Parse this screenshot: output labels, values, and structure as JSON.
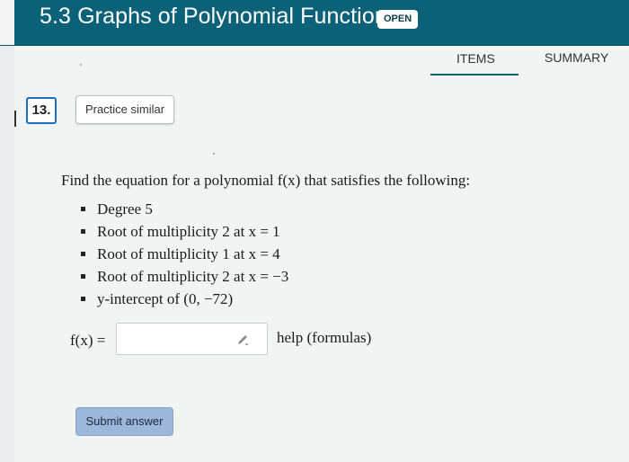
{
  "header": {
    "title": "5.3 Graphs of Polynomial Functions",
    "badge": "OPEN"
  },
  "tabs": {
    "items": "ITEMS",
    "summary": "SUMMARY",
    "active": "ITEMS"
  },
  "question": {
    "number": "13.",
    "practice_label": "Practice similar",
    "prompt": "Find the equation for a polynomial f(x) that satisfies the following:",
    "requirements": [
      "Degree 5",
      "Root of multiplicity 2 at x = 1",
      "Root of multiplicity 1 at x = 4",
      "Root of multiplicity 2 at x = −3",
      "y-intercept of (0, −72)"
    ],
    "answer_label": "f(x) =",
    "answer_value": "",
    "help_label": "help (formulas)",
    "submit_label": "Submit answer",
    "pencil_icon": "pencil-icon"
  },
  "colors": {
    "header": "#0a6178",
    "accent": "#1b6ec2",
    "submit": "#9cb7d8"
  }
}
